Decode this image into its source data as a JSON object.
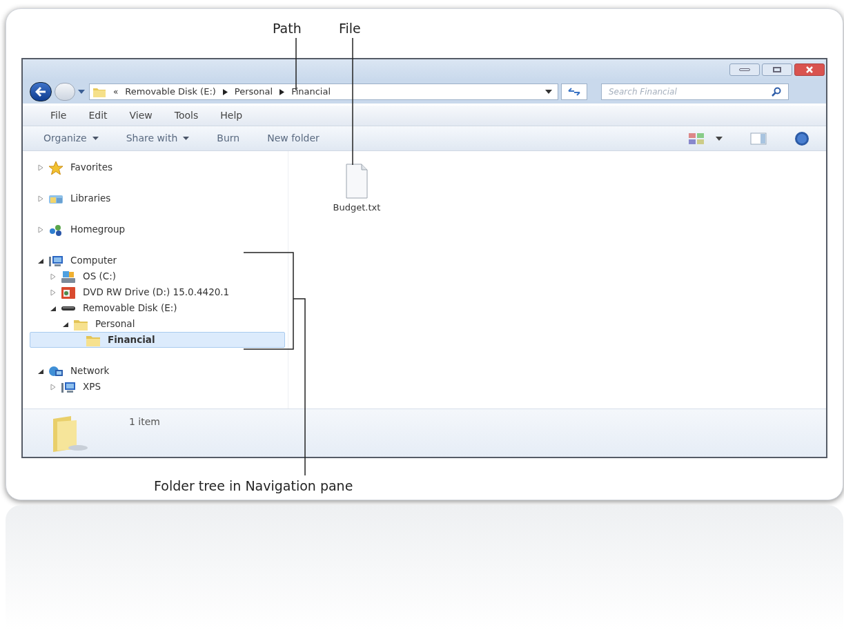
{
  "annotations": {
    "path": "Path",
    "file": "File",
    "tree": "Folder tree in Navigation pane"
  },
  "address_bar": {
    "overflow": "«",
    "segments": [
      "Removable Disk (E:)",
      "Personal",
      "Financial"
    ]
  },
  "search": {
    "placeholder": "Search Financial"
  },
  "menu": [
    "File",
    "Edit",
    "View",
    "Tools",
    "Help"
  ],
  "toolbar": [
    {
      "label": "Organize",
      "dropdown": true
    },
    {
      "label": "Share with",
      "dropdown": true
    },
    {
      "label": "Burn",
      "dropdown": false
    },
    {
      "label": "New folder",
      "dropdown": false
    }
  ],
  "nav_tree": [
    {
      "label": "Favorites",
      "kind": "star",
      "expanded": false,
      "selected": false
    },
    {
      "label": "Libraries",
      "kind": "library",
      "expanded": false,
      "selected": false
    },
    {
      "label": "Homegroup",
      "kind": "homegroup",
      "expanded": false,
      "selected": false
    },
    {
      "label": "Computer",
      "kind": "computer",
      "expanded": true,
      "selected": false,
      "children": [
        {
          "label": "OS (C:)",
          "kind": "drive",
          "expanded": false,
          "selected": false
        },
        {
          "label": "DVD RW Drive (D:) 15.0.4420.1",
          "kind": "dvd",
          "expanded": false,
          "selected": false
        },
        {
          "label": "Removable Disk (E:)",
          "kind": "removable",
          "expanded": true,
          "selected": false,
          "children": [
            {
              "label": "Personal",
              "kind": "folder",
              "expanded": true,
              "selected": false,
              "children": [
                {
                  "label": "Financial",
                  "kind": "folder",
                  "selected": true
                }
              ]
            }
          ]
        }
      ]
    },
    {
      "label": "Network",
      "kind": "network",
      "expanded": true,
      "selected": false,
      "children": [
        {
          "label": "XPS",
          "kind": "computer",
          "expanded": false,
          "selected": false
        }
      ]
    }
  ],
  "files": [
    {
      "name": "Budget.txt",
      "kind": "text"
    }
  ],
  "status_bar": {
    "text": "1 item"
  }
}
